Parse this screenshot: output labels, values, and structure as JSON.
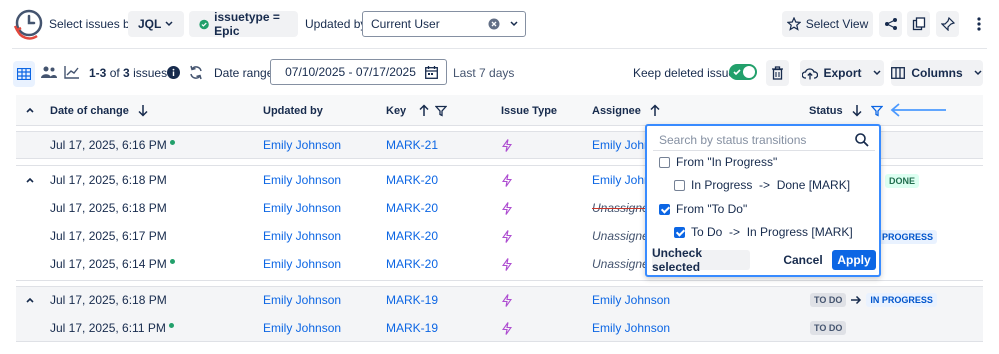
{
  "toolbar": {
    "select_by_label": "Select issues by:",
    "jql_label": "JQL",
    "filter_chip": "issuetype = Epic",
    "updated_by_label": "Updated by:",
    "updated_by_value": "Current User",
    "select_view_label": "Select View"
  },
  "subbar": {
    "count_range": "1-3",
    "count_of": "of",
    "count_total": "3",
    "count_unit": "issues",
    "date_range_label": "Date range:",
    "date_range_value": "07/10/2025 - 07/17/2025",
    "date_hint": "Last 7 days",
    "keep_deleted_label": "Keep deleted issues",
    "keep_deleted_on": true,
    "export_label": "Export",
    "columns_label": "Columns"
  },
  "columns": {
    "date": "Date of change",
    "updated_by": "Updated by",
    "key": "Key",
    "issue_type": "Issue Type",
    "assignee": "Assignee",
    "status": "Status"
  },
  "rows": [
    {
      "date": "Jul 17, 2025, 6:16 PM",
      "user": "Emily Johnson",
      "key": "MARK-21",
      "assignee": "Emily Johns"
    },
    {
      "date": "Jul 17, 2025, 6:18 PM",
      "user": "Emily Johnson",
      "key": "MARK-20",
      "assignee": "Emily Johns",
      "status_to": "DONE"
    },
    {
      "date": "Jul 17, 2025, 6:18 PM",
      "user": "Emily Johnson",
      "key": "MARK-20",
      "assignee": "Unassigned"
    },
    {
      "date": "Jul 17, 2025, 6:17 PM",
      "user": "Emily Johnson",
      "key": "MARK-20",
      "assignee": "Unassigned",
      "status_to": "PROGRESS"
    },
    {
      "date": "Jul 17, 2025, 6:14 PM",
      "user": "Emily Johnson",
      "key": "MARK-20",
      "assignee": "Unassigned"
    },
    {
      "date": "Jul 17, 2025, 6:18 PM",
      "user": "Emily Johnson",
      "key": "MARK-19",
      "assignee": "Emily Johnson",
      "status_from": "TO DO",
      "status_to": "IN PROGRESS"
    },
    {
      "date": "Jul 17, 2025, 6:11 PM",
      "user": "Emily Johnson",
      "key": "MARK-19",
      "assignee": "Emily Johnson",
      "status_from": "TO DO"
    }
  ],
  "status_filter": {
    "search_placeholder": "Search by status transitions",
    "options": [
      {
        "label": "From \"In Progress\"",
        "checked": false
      },
      {
        "label": "In Progress  ->  Done [MARK]",
        "checked": false
      },
      {
        "label": "From \"To Do\"",
        "checked": true
      },
      {
        "label": "To Do  ->  In Progress [MARK]",
        "checked": true
      }
    ],
    "uncheck_label": "Uncheck selected",
    "cancel_label": "Cancel",
    "apply_label": "Apply"
  },
  "colors": {
    "accent": "#0c66e4",
    "toggle_on": "#22a06b",
    "epic_icon": "#ae4ed1"
  }
}
